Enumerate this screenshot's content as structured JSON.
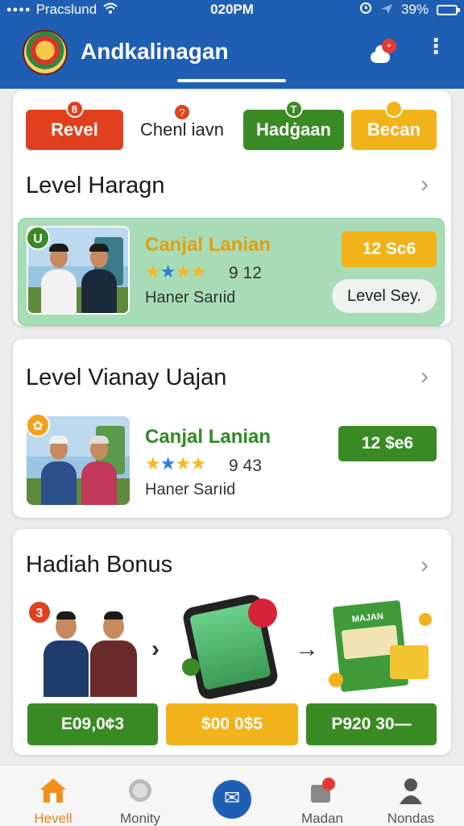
{
  "status_bar": {
    "carrier": "Pracslund",
    "time": "020PM",
    "battery": "39%",
    "battery_level": 0.39
  },
  "header": {
    "title": "Andkalinagan",
    "notification_badge": "+"
  },
  "chips": [
    {
      "label": "Revel",
      "badge": "8",
      "color": "#e0401d"
    },
    {
      "label": "Chenl iavn",
      "badge": "?",
      "color": "#e0401d"
    },
    {
      "label": "Hadġaan",
      "badge": "T",
      "color": "#3a8a24"
    },
    {
      "label": "Becan",
      "badge": "",
      "color": "#f2b21a"
    }
  ],
  "section1": {
    "title": "Level Haragn",
    "offer": {
      "corner_badge": "U",
      "title": "Canjal Lanian",
      "rating": "9 12",
      "seller": "Haner Sarıid",
      "price": "12 Sc6",
      "action": "Level Sey."
    }
  },
  "section2": {
    "title": "Level Vianay Uajan",
    "offer": {
      "title": "Canjal Lanian",
      "rating": "9 43",
      "seller": "Haner Sarıid",
      "price": "12 $e6"
    }
  },
  "section3": {
    "title": "Hadiah Bonus",
    "badge": "3",
    "box_label": "MAJAN",
    "buttons": [
      "E09,0¢3",
      "$00 0$5",
      "P920 30—"
    ]
  },
  "bottom_nav": [
    {
      "label": "Hevell",
      "active": true
    },
    {
      "label": "Monity",
      "active": false
    },
    {
      "label": "",
      "active": false
    },
    {
      "label": "Madan",
      "active": false
    },
    {
      "label": "Nondas",
      "active": false
    }
  ],
  "colors": {
    "brand": "#1e5fb3",
    "green": "#3a8a24",
    "orange": "#f2b21a",
    "red": "#e0401d"
  }
}
